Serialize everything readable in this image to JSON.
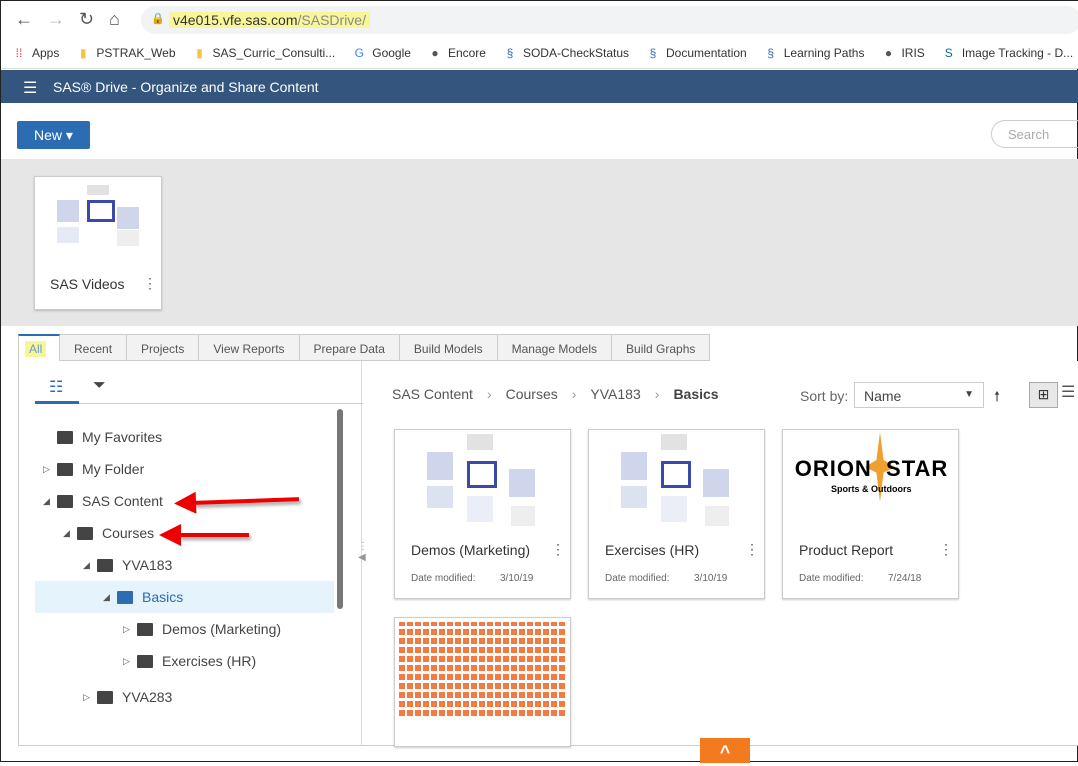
{
  "browser": {
    "url_host": "v4e015.vfe.sas.com",
    "url_path": "/SASDrive/",
    "bookmarks": [
      {
        "label": "Apps",
        "icon": "apps-grid-icon"
      },
      {
        "label": "PSTRAK_Web",
        "icon": "folder-icon"
      },
      {
        "label": "SAS_Curric_Consulti...",
        "icon": "folder-icon"
      },
      {
        "label": "Google",
        "icon": "google-icon"
      },
      {
        "label": "Encore",
        "icon": "globe-icon"
      },
      {
        "label": "SODA-CheckStatus",
        "icon": "sas-icon"
      },
      {
        "label": "Documentation",
        "icon": "sas-icon"
      },
      {
        "label": "Learning Paths",
        "icon": "sas-icon"
      },
      {
        "label": "IRIS",
        "icon": "globe-icon"
      },
      {
        "label": "Image Tracking - D...",
        "icon": "sharepoint-icon"
      }
    ]
  },
  "app": {
    "title": "SAS® Drive - Organize and Share Content",
    "new_label": "New ▾",
    "search_placeholder": "Search"
  },
  "shelf": [
    {
      "name": "SAS Videos"
    }
  ],
  "tabs": [
    "All",
    "Recent",
    "Projects",
    "View Reports",
    "Prepare Data",
    "Build Models",
    "Manage Models",
    "Build Graphs"
  ],
  "tree": [
    {
      "label": "My Favorites",
      "level": 0,
      "tw": ""
    },
    {
      "label": "My Folder",
      "level": 0,
      "tw": "▷"
    },
    {
      "label": "SAS Content",
      "level": 0,
      "tw": "◢"
    },
    {
      "label": "Courses",
      "level": 1,
      "tw": "◢"
    },
    {
      "label": "YVA183",
      "level": 2,
      "tw": "◢"
    },
    {
      "label": "Basics",
      "level": 3,
      "tw": "◢",
      "selected": true
    },
    {
      "label": "Demos (Marketing)",
      "level": 4,
      "tw": "▷"
    },
    {
      "label": "Exercises (HR)",
      "level": 4,
      "tw": "▷"
    },
    {
      "label": "YVA283",
      "level": 2,
      "tw": "▷"
    }
  ],
  "breadcrumb": [
    "SAS Content",
    "Courses",
    "YVA183",
    "Basics"
  ],
  "sort": {
    "label": "Sort by:",
    "value": "Name"
  },
  "cards": [
    {
      "name": "Demos (Marketing)",
      "date_label": "Date modified:",
      "date": "3/10/19",
      "type": "folder"
    },
    {
      "name": "Exercises (HR)",
      "date_label": "Date modified:",
      "date": "3/10/19",
      "type": "folder"
    },
    {
      "name": "Product Report",
      "date_label": "Date modified:",
      "date": "7/24/18",
      "type": "report",
      "logo_text": "ORION STAR",
      "logo_sub": "Sports & Outdoors"
    }
  ],
  "colors": {
    "header": "#34557d",
    "accent": "#2b6cb3",
    "scroll_top": "#f47a1f"
  }
}
